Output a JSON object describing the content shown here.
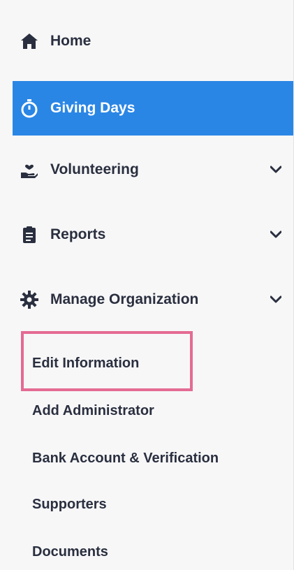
{
  "nav": {
    "items": [
      {
        "label": "Home",
        "icon": "home-icon"
      },
      {
        "label": "Giving Days",
        "icon": "stopwatch-icon",
        "active": true
      },
      {
        "label": "Volunteering",
        "icon": "hand-heart-icon",
        "has_chevron": true
      },
      {
        "label": "Reports",
        "icon": "clipboard-icon",
        "has_chevron": true
      },
      {
        "label": "Manage Organization",
        "icon": "gear-icon",
        "has_chevron": true,
        "expanded": true
      }
    ],
    "sub_items": [
      {
        "label": "Edit Information",
        "highlighted": true
      },
      {
        "label": "Add Administrator"
      },
      {
        "label": "Bank Account & Verification"
      },
      {
        "label": "Supporters"
      },
      {
        "label": "Documents"
      }
    ]
  },
  "colors": {
    "active_bg": "#2a86e5",
    "text": "#2a2f3f",
    "highlight_border": "#e46b93",
    "sidebar_bg": "#f7f7f8"
  }
}
